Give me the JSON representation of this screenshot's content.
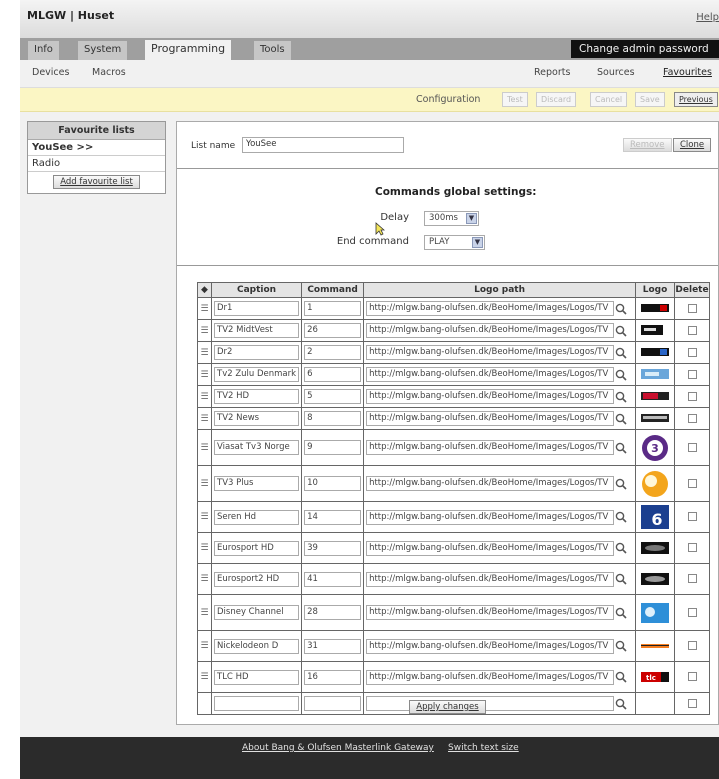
{
  "app": {
    "title": "MLGW | Huset",
    "help": "Help"
  },
  "main_tabs": [
    {
      "label": "Info"
    },
    {
      "label": "System"
    },
    {
      "label": "Programming",
      "active": true
    },
    {
      "label": "Tools"
    }
  ],
  "change_password": "Change admin password",
  "subnav": {
    "left": [
      "Devices",
      "Macros"
    ],
    "right": [
      "Reports",
      "Sources",
      "Favourites"
    ]
  },
  "configbar": {
    "label": "Configuration",
    "buttons": [
      "Test",
      "Discard",
      "Cancel",
      "Save",
      "Previous"
    ]
  },
  "sidebar": {
    "title": "Favourite lists",
    "items": [
      {
        "label": "YouSee >>",
        "selected": true
      },
      {
        "label": "Radio"
      }
    ],
    "add_button": "Add favourite list"
  },
  "list": {
    "label": "List name",
    "value": "YouSee",
    "remove": "Remove",
    "clone": "Clone"
  },
  "global_settings": {
    "title": "Commands global settings:",
    "delay_label": "Delay",
    "delay_value": "300ms",
    "end_label": "End command",
    "end_value": "PLAY"
  },
  "table": {
    "headers": [
      "Caption",
      "Command",
      "Logo path",
      "Logo",
      "Delete"
    ],
    "rows": [
      {
        "caption": "Dr1",
        "command": "1",
        "path": "http://mlgw.bang-olufsen.dk/BeoHome/Images/Logos/TV",
        "logo": "dr1-logo"
      },
      {
        "caption": "TV2 MidtVest",
        "command": "26",
        "path": "http://mlgw.bang-olufsen.dk/BeoHome/Images/Logos/TV",
        "logo": "tv2-midtvest-logo"
      },
      {
        "caption": "Dr2",
        "command": "2",
        "path": "http://mlgw.bang-olufsen.dk/BeoHome/Images/Logos/TV",
        "logo": "dr2-logo"
      },
      {
        "caption": "Tv2 Zulu Denmark",
        "command": "6",
        "path": "http://mlgw.bang-olufsen.dk/BeoHome/Images/Logos/TV",
        "logo": "tv2-zulu-logo"
      },
      {
        "caption": "TV2 HD",
        "command": "5",
        "path": "http://mlgw.bang-olufsen.dk/BeoHome/Images/Logos/TV",
        "logo": "tv2-hd-logo"
      },
      {
        "caption": "TV2 News",
        "command": "8",
        "path": "http://mlgw.bang-olufsen.dk/BeoHome/Images/Logos/TV",
        "logo": "tv2-news-logo"
      },
      {
        "caption": "Viasat Tv3 Norge",
        "command": "9",
        "path": "http://mlgw.bang-olufsen.dk/BeoHome/Images/Logos/TV",
        "logo": "tv3-logo",
        "tall": true
      },
      {
        "caption": "TV3 Plus",
        "command": "10",
        "path": "http://mlgw.bang-olufsen.dk/BeoHome/Images/Logos/TV",
        "logo": "tv3-plus-logo",
        "tall": true
      },
      {
        "caption": "Seren Hd",
        "command": "14",
        "path": "http://mlgw.bang-olufsen.dk/BeoHome/Images/Logos/TV",
        "logo": "kanal6-logo"
      },
      {
        "caption": "Eurosport HD",
        "command": "39",
        "path": "http://mlgw.bang-olufsen.dk/BeoHome/Images/Logos/TV",
        "logo": "eurosport-logo"
      },
      {
        "caption": "Eurosport2 HD",
        "command": "41",
        "path": "http://mlgw.bang-olufsen.dk/BeoHome/Images/Logos/TV",
        "logo": "eurosport2-logo"
      },
      {
        "caption": "Disney Channel",
        "command": "28",
        "path": "http://mlgw.bang-olufsen.dk/BeoHome/Images/Logos/TV",
        "logo": "disney-logo",
        "tall": true
      },
      {
        "caption": "Nickelodeon D",
        "command": "31",
        "path": "http://mlgw.bang-olufsen.dk/BeoHome/Images/Logos/TV",
        "logo": "nickelodeon-logo"
      },
      {
        "caption": "TLC HD",
        "command": "16",
        "path": "http://mlgw.bang-olufsen.dk/BeoHome/Images/Logos/TV",
        "logo": "tlc-logo"
      }
    ]
  },
  "apply_button": "Apply changes",
  "footer": {
    "about": "About Bang & Olufsen Masterlink Gateway",
    "switch": "Switch text size"
  },
  "colors": {
    "config_bar": "#fbf6c4",
    "footer": "#2b2b2b",
    "tab_bar": "#9f9f9f"
  }
}
